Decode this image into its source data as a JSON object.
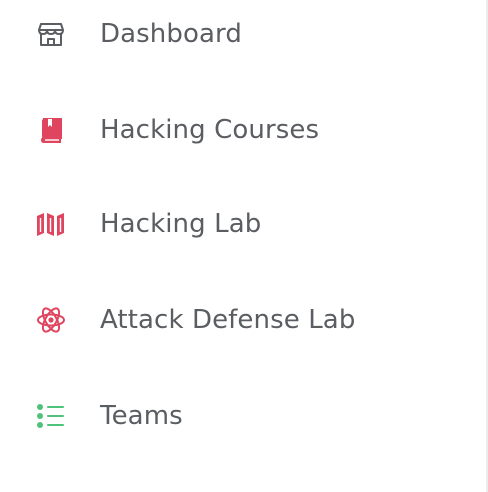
{
  "nav": {
    "items": [
      {
        "label": "Dashboard",
        "icon": "store-icon",
        "color": "#5a5d61"
      },
      {
        "label": "Hacking Courses",
        "icon": "book-icon",
        "color": "#e0455f"
      },
      {
        "label": "Hacking Lab",
        "icon": "map-icon",
        "color": "#e0455f"
      },
      {
        "label": "Attack Defense Lab",
        "icon": "atom-icon",
        "color": "#e0455f"
      },
      {
        "label": "Teams",
        "icon": "list-icon",
        "color": "#4fc27a"
      }
    ]
  }
}
